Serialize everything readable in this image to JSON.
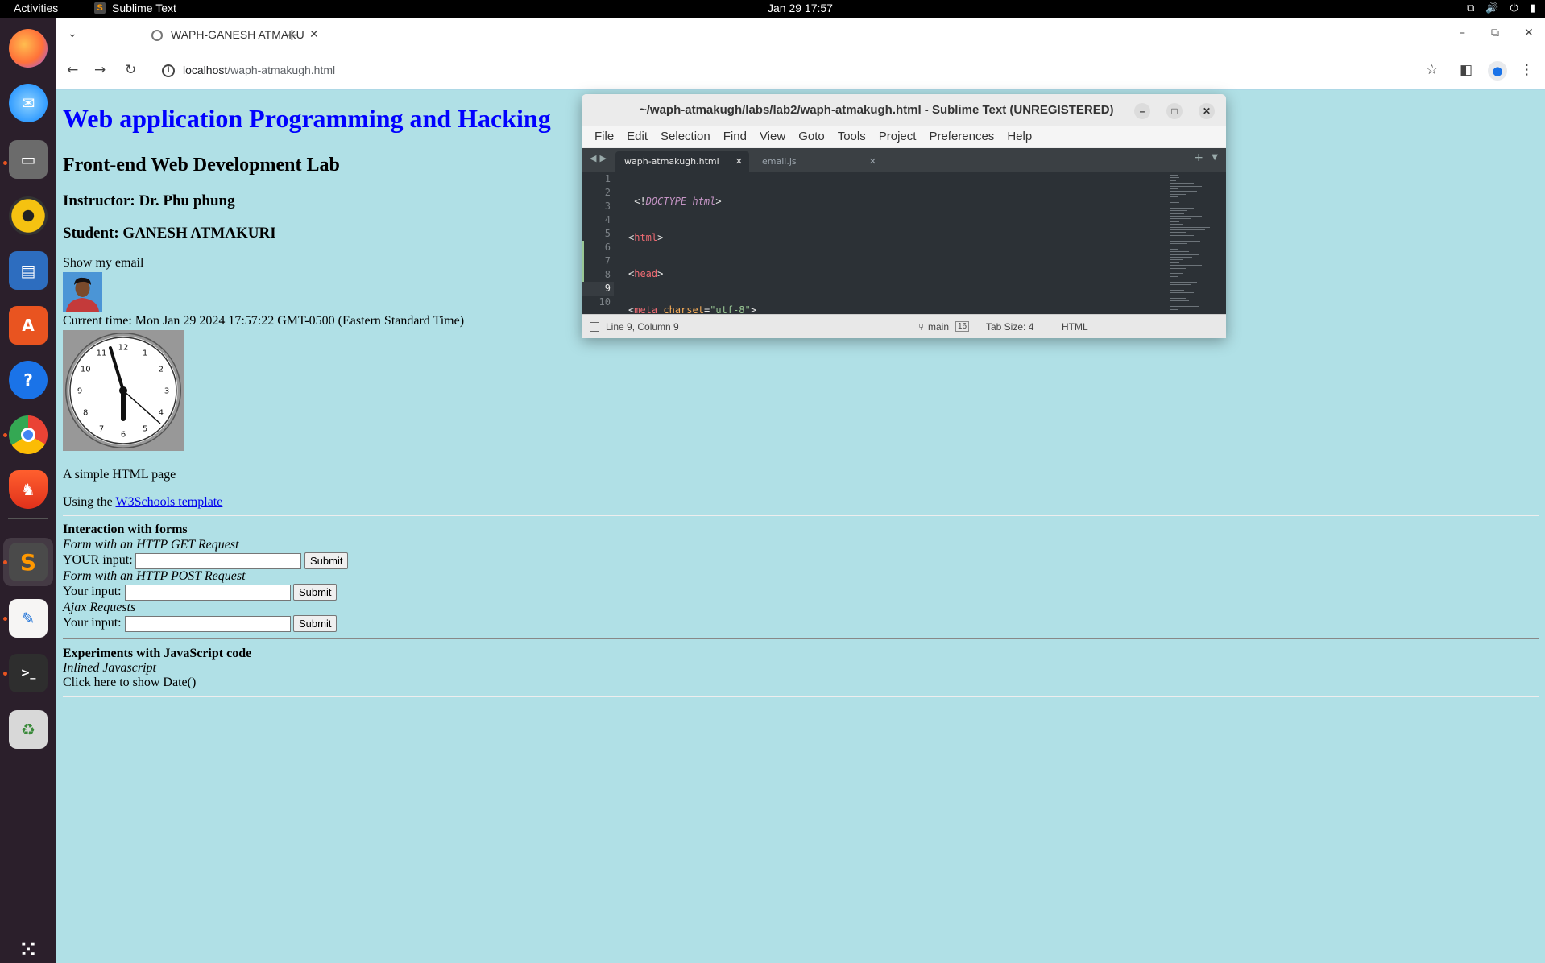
{
  "topbar": {
    "activities": "Activities",
    "app_name": "Sublime Text",
    "datetime": "Jan 29  17:57"
  },
  "dock": {
    "items": [
      "firefox-icon",
      "thunderbird-icon",
      "files-icon",
      "rhythmbox-icon",
      "writer-icon",
      "app-center-icon",
      "help-icon",
      "chrome-icon",
      "brave-icon",
      "sublime-text-icon",
      "text-editor-icon",
      "terminal-icon",
      "trash-icon",
      "show-apps-icon"
    ]
  },
  "browser": {
    "tab_title": "WAPH-GANESH ATMAKURI",
    "url_host": "localhost",
    "url_path": "/waph-atmakugh.html"
  },
  "page": {
    "h1": "Web application Programming and Hacking",
    "h2": "Front-end Web Development Lab",
    "instructor": "Instructor: Dr. Phu phung",
    "student": "Student: GANESH ATMAKURI",
    "show_email": "Show my email",
    "current_time": "Current time: Mon Jan 29 2024 17:57:22 GMT-0500 (Eastern Standard Time)",
    "clock_numbers": [
      "12",
      "1",
      "2",
      "3",
      "4",
      "5",
      "6",
      "7",
      "8",
      "9",
      "10",
      "11"
    ],
    "simple_page": "A simple HTML page",
    "using_prefix": "Using the ",
    "w3_link": "W3Schools template",
    "forms_heading": "Interaction with forms",
    "get_form_label": "Form with an HTTP GET Request",
    "get_input_label": "YOUR input:",
    "post_form_label": "Form with an HTTP POST Request",
    "post_input_label": "Your input:",
    "ajax_label": "Ajax Requests",
    "ajax_input_label": "Your input:",
    "submit": "Submit",
    "js_heading": "Experiments with JavaScript code",
    "inline_js": "Inlined Javascript",
    "show_date": "Click here to show Date()"
  },
  "sublime": {
    "title": "~/waph-atmakugh/labs/lab2/waph-atmakugh.html - Sublime Text (UNREGISTERED)",
    "menu": [
      "File",
      "Edit",
      "Selection",
      "Find",
      "View",
      "Goto",
      "Tools",
      "Project",
      "Preferences",
      "Help"
    ],
    "tab_active": "waph-atmakugh.html",
    "tab_inactive": "email.js",
    "line_numbers": [
      "1",
      "2",
      "3",
      "4",
      "5",
      "6",
      "7",
      "8",
      "9",
      "10"
    ],
    "status_position": "Line 9, Column 9",
    "status_branch": "main",
    "status_changes": "16",
    "status_tabsize": "Tab Size: 4",
    "status_syntax": "HTML"
  },
  "colors": {
    "page_background": "#b0e0e6",
    "heading_blue": "#0000ff",
    "editor_background": "#2c3136"
  }
}
